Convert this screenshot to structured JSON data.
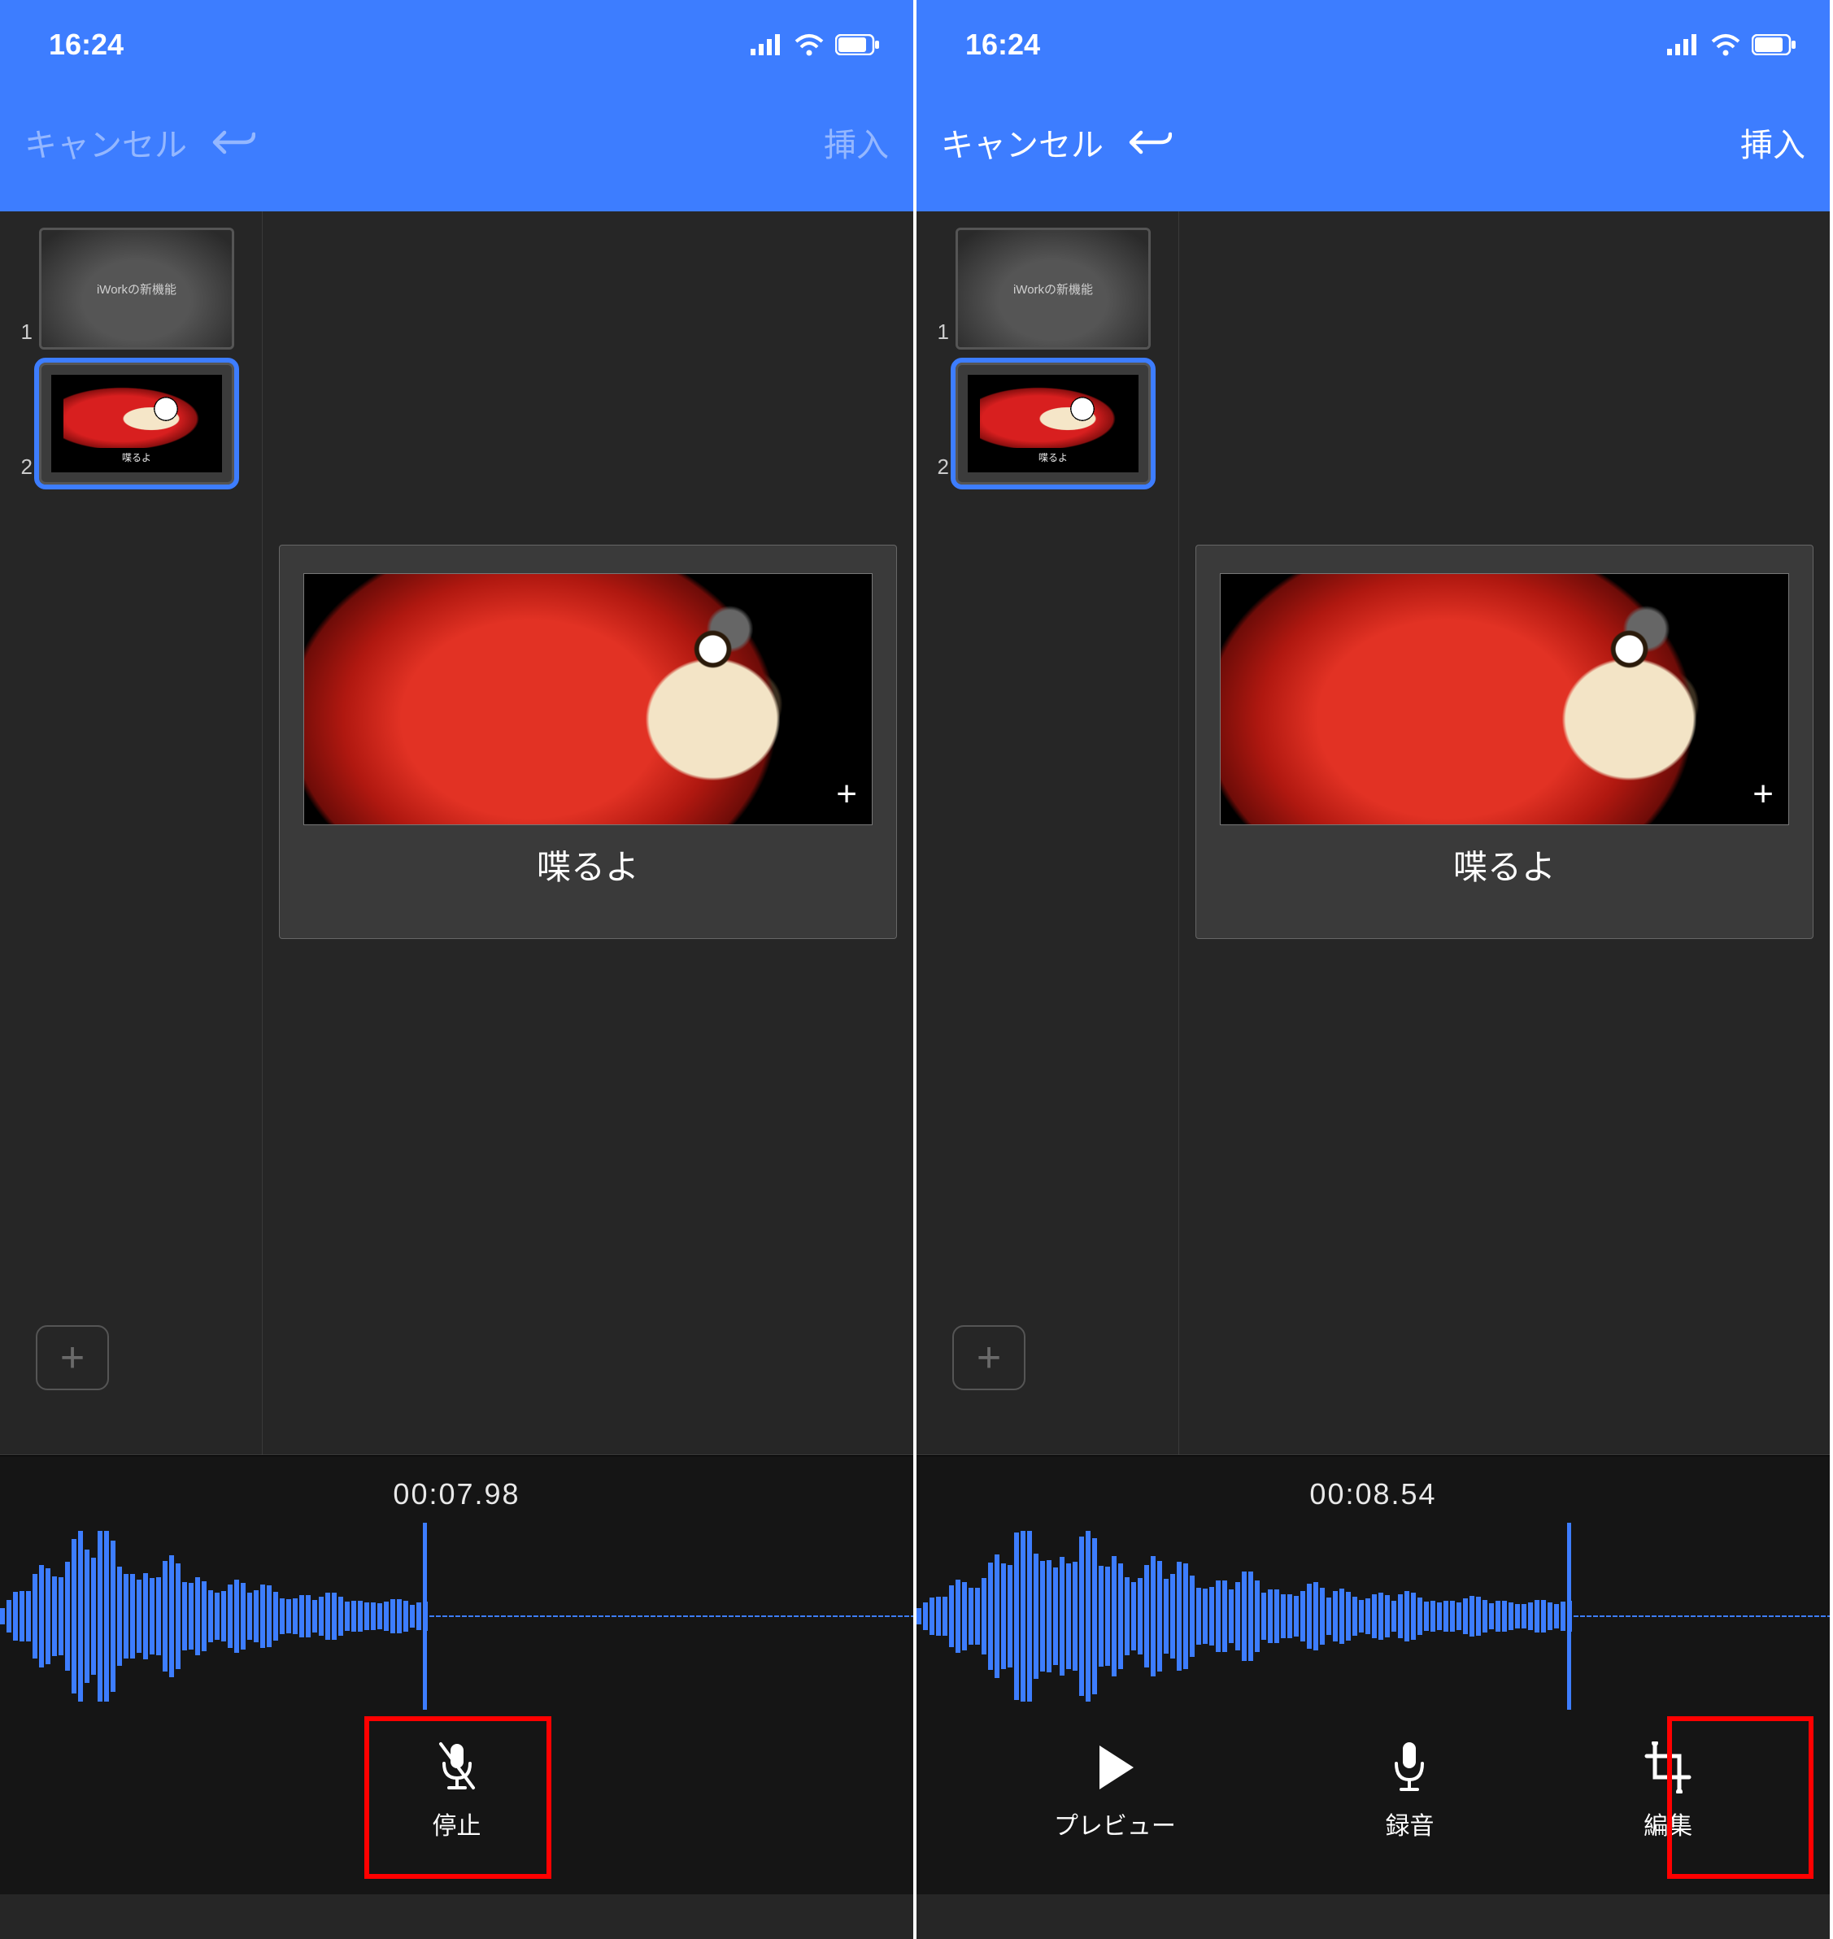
{
  "left": {
    "status_time": "16:24",
    "nav": {
      "cancel": "キャンセル",
      "insert": "挿入",
      "cancel_enabled": false,
      "undo_enabled": false,
      "insert_enabled": false
    },
    "thumbs": [
      {
        "num": "1",
        "title": "iWorkの新機能",
        "selected": false,
        "type": "title"
      },
      {
        "num": "2",
        "caption": "喋るよ",
        "selected": true,
        "type": "parrot"
      }
    ],
    "slide": {
      "caption": "喋るよ"
    },
    "timecode": "00:07.98",
    "controls": {
      "stop": "停止"
    }
  },
  "right": {
    "status_time": "16:24",
    "nav": {
      "cancel": "キャンセル",
      "insert": "挿入",
      "cancel_enabled": true,
      "undo_enabled": true,
      "insert_enabled": true
    },
    "thumbs": [
      {
        "num": "1",
        "title": "iWorkの新機能",
        "selected": false,
        "type": "title"
      },
      {
        "num": "2",
        "caption": "喋るよ",
        "selected": true,
        "type": "parrot"
      }
    ],
    "slide": {
      "caption": "喋るよ"
    },
    "timecode": "00:08.54",
    "controls": {
      "preview": "プレビュー",
      "record": "録音",
      "edit": "編集"
    }
  },
  "icons": {
    "signal": "signal-icon",
    "wifi": "wifi-icon",
    "battery": "battery-icon",
    "undo": "undo-icon",
    "plus": "+",
    "mic_off": "mic-muted-icon",
    "play": "play-icon",
    "mic": "mic-icon",
    "crop": "crop-icon"
  }
}
